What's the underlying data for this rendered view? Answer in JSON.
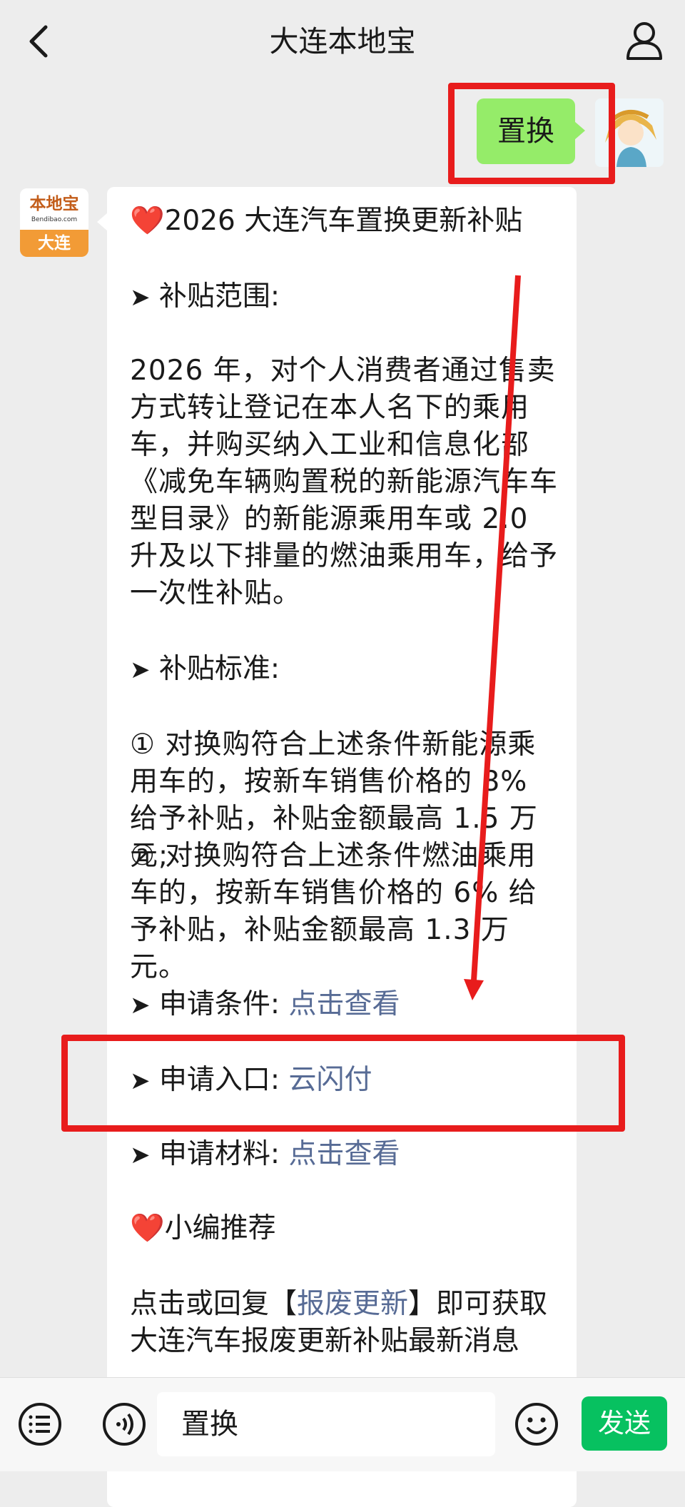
{
  "header": {
    "title": "大连本地宝",
    "back_icon": "chevron-left-icon",
    "profile_icon": "person-icon"
  },
  "outgoing": {
    "text": "置换"
  },
  "incoming": {
    "avatar": {
      "name": "本地宝",
      "url": "Bendibao.com",
      "city": "大连"
    },
    "heading_heart": "❤️",
    "heading": "2026 大连汽车置换更新补贴",
    "bullet": "➤",
    "section1_title": "补贴范围:",
    "section1_text": "2026 年，对个人消费者通过售卖方式转让登记在本人名下的乘用车，并购买纳入工业和信息化部《减免车辆购置税的新能源汽车车型目录》的新能源乘用车或 2.0 升及以下排量的燃油乘用车，给予一次性补贴。",
    "section2_title": "补贴标准:",
    "standard1": "① 对换购符合上述条件新能源乘用车的，按新车销售价格的 8% 给予补贴，补贴金额最高 1.5 万元;",
    "standard2": "② 对换购符合上述条件燃油乘用车的，按新车销售价格的 6% 给予补贴，补贴金额最高 1.3 万元。",
    "cond_label": "申请条件:",
    "cond_link": "点击查看",
    "entry_label": "申请入口:",
    "entry_link": "云闪付",
    "material_label": "申请材料:",
    "material_link": "点击查看",
    "recommend": "小编推荐",
    "reply_prefix": "点击或回复【",
    "reply_link": "报废更新",
    "reply_suffix": "】即可获取",
    "reply_line2": "大连汽车报废更新补贴最新消息"
  },
  "input_bar": {
    "menu_icon": "list-icon",
    "voice_icon": "voice-icon",
    "input_value": "置换",
    "emoji_icon": "smile-icon",
    "send_label": "发送"
  },
  "colors": {
    "background": "#ededed",
    "outgoing_bubble": "#95ec69",
    "link": "#576b95",
    "send_button": "#07c160",
    "annotation": "#e81c1c"
  }
}
